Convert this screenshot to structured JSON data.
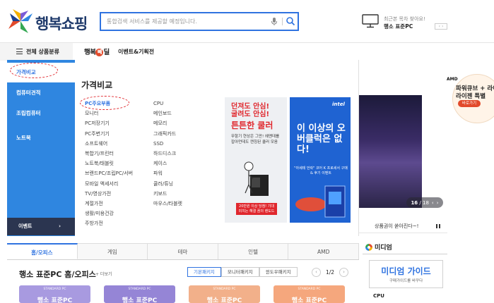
{
  "header": {
    "logo_text": "행복쇼핑",
    "search_placeholder": "통합검색 서비스를 제공할 예정입니다.",
    "recent_label": "최근본 목차 찾아요!",
    "recent_item": "행소 표준PC",
    "recent_pager": "‹ ›"
  },
  "nav": {
    "all_categories": "전체 상품분류",
    "happy_logo_a": "행복",
    "happy_logo_b": "빼",
    "happy_logo_c": "딜",
    "event": "이벤트&기획전"
  },
  "sidemenu": {
    "items": [
      {
        "label": "가격비교"
      },
      {
        "label": "컴퓨터견적"
      },
      {
        "label": "조립컴퓨터"
      },
      {
        "label": "노트북"
      }
    ],
    "event_label": "이벤트",
    "event_arrow": "›"
  },
  "mega": {
    "title": "가격비교",
    "col1": [
      "PC주요부품",
      "모니터",
      "PC저장기기",
      "PC주변기기",
      "소프트웨어",
      "복합기/프린터",
      "노트북/태블릿",
      "브랜드PC/조립PC/서버",
      "모바일 액세서리",
      "TV/영상가전",
      "계절가전",
      "생활/미용건강",
      "주방가전"
    ],
    "col2": [
      "CPU",
      "메인보드",
      "메모리",
      "그래픽카드",
      "SSD",
      "하드디스크",
      "케이스",
      "파워",
      "쿨러/튜닝",
      "키보드",
      "마우스/타블렛"
    ],
    "banner1": {
      "line1": "던져도 안심!",
      "line1b": "굴려도 안심!",
      "line2": "튼튼한 쿨러",
      "sub": "무항기 현상은 그만! 헤멘데를 잡아먼데도 캔칭된 쿨러 모음",
      "foot": "20만원 이상 당첨! 기대 미치는 해결 꿈의 렌도드"
    },
    "banner2": {
      "intel": "intel",
      "line": "이 이상의 오버클럭은 없다!",
      "sub": "\"아세테 언락\" 코어 K 프로세서 구매 & 후기 이벤트"
    }
  },
  "hero": {
    "amd_logo": "AMD",
    "amd_t1": "파워큐브 + 라이젠",
    "amd_t2": "라이젠 특별",
    "amd_btn": "바로가기",
    "pager_current": "16",
    "pager_total": "18",
    "notice": "상품권이 쏟아진다~!"
  },
  "section": {
    "tabs": [
      {
        "label": "홈/오피스"
      },
      {
        "label": "게임"
      },
      {
        "label": "테마"
      },
      {
        "label": "인텔"
      },
      {
        "label": "AMD"
      }
    ],
    "title": "행소 표준PC 홈/오피스",
    "more": "+ 더보기",
    "subtabs": [
      {
        "label": "기본패키지"
      },
      {
        "label": "모니터패키지"
      },
      {
        "label": "윈도우패키지"
      }
    ],
    "page_label": "1/2",
    "prev": "‹",
    "next": "›",
    "cards": [
      {
        "top": "STANDARD PC",
        "title": "행소 표준PC",
        "color": "#a89ae0"
      },
      {
        "top": "STANDARD PC",
        "title": "행소 표준PC",
        "color": "#9585d6"
      },
      {
        "top": "STANDARD PC",
        "title": "행소 표준PC",
        "color": "#f2b08a"
      },
      {
        "top": "STANDARD PC",
        "title": "행소 표준PC",
        "color": "#f5a77d"
      }
    ]
  },
  "media": {
    "logo": "미디엄",
    "box_title": "미디엄 가이드",
    "box_sub": "구매가이드를 바꾸다",
    "item": "CPU"
  }
}
